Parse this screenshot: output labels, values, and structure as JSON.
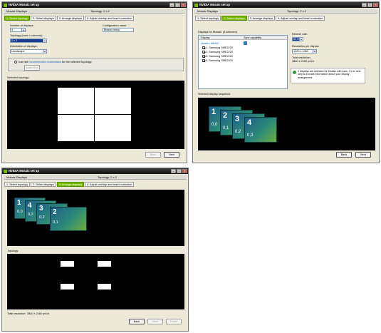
{
  "win1": {
    "title": "NVIDIA Mosaic set up",
    "subheader": {
      "left": "Mosaic Displays",
      "right": "Topology: 2 x 2"
    },
    "tabs": [
      "1. Select topology",
      "2. Select displays",
      "3. Arrange displays",
      "4. Adjust overlap and bezel correction"
    ],
    "number_of_displays_label": "Number of displays:",
    "number_of_displays_value": "4",
    "topology_label": "Topology (rows x columns):",
    "topology_value": "2 x 2",
    "orientation_label": "Orientation of displays:",
    "orientation_value": "Landscape",
    "config_name_label": "Configuration name:",
    "config_name_value": "Mosaic setup",
    "connections_pre": "I can set ",
    "connections_link": "recommended connections",
    "connections_post": " for the selected topology.",
    "apply_button": "Apply Now",
    "selected_topology_label": "Selected topology:",
    "back_button": "Back",
    "next_button": "Next"
  },
  "win2": {
    "title": "NVIDIA Mosaic set up",
    "subheader": {
      "left": "Mosaic Displays",
      "right": "Topology: 2 x 2"
    },
    "tabs": [
      "1. Select topology",
      "2. Select displays",
      "3. Arrange displays",
      "4. Adjust overlap and bezel correction"
    ],
    "displays_label": "Displays for Mosaic: (4 selected)",
    "col_display": "Display",
    "col_sync": "Sync capability",
    "gpu_name": "Quadro M6000",
    "displays": [
      "1. Samsung SME2220",
      "2. Samsung SME2220",
      "3. Samsung SME2220",
      "4. Samsung SME2220"
    ],
    "refresh_label": "Refresh rate:",
    "refresh_value": "60 Hz",
    "resolution_label": "Resolution per display:",
    "resolution_value": "1920 x 1080",
    "total_res_label": "Total resolution:",
    "total_res_value": "3840 x 2160 px/ch",
    "info_text": "4 displays are selected for Mosaic with sync. Go to next step to provide information about your display arrangement.",
    "selected_label": "Selected display sequence:",
    "tiles": [
      {
        "num": "1",
        "coord": "0,0"
      },
      {
        "num": "2",
        "coord": "0,1"
      },
      {
        "num": "3",
        "coord": "0,2"
      },
      {
        "num": "4",
        "coord": "0,3"
      }
    ],
    "back_button": "Back",
    "next_button": "Next"
  },
  "win3": {
    "title": "NVIDIA Mosaic set up",
    "subheader": {
      "left": "Mosaic Displays",
      "right": "Topology: 2 x 2"
    },
    "tabs": [
      "1. Select topology",
      "2. Select displays",
      "3. Arrange displays",
      "4. Adjust overlap and bezel correction"
    ],
    "tiles": [
      {
        "num": "1",
        "coord": "0,0"
      },
      {
        "num": "4",
        "coord": "0,3"
      },
      {
        "num": "3",
        "coord": "0,2"
      },
      {
        "num": "2",
        "coord": "0,1"
      }
    ],
    "topology_label": "Topology:",
    "total_res_label": "Total resolution:",
    "total_res_value": "3840 x 2160 px/ch",
    "back_button": "Back",
    "next_button": "Next",
    "finish_button": "Finish"
  },
  "colors": {
    "nvidia_green": "#76b900",
    "canvas": "#000000",
    "window_bg": "#ece9d8"
  }
}
